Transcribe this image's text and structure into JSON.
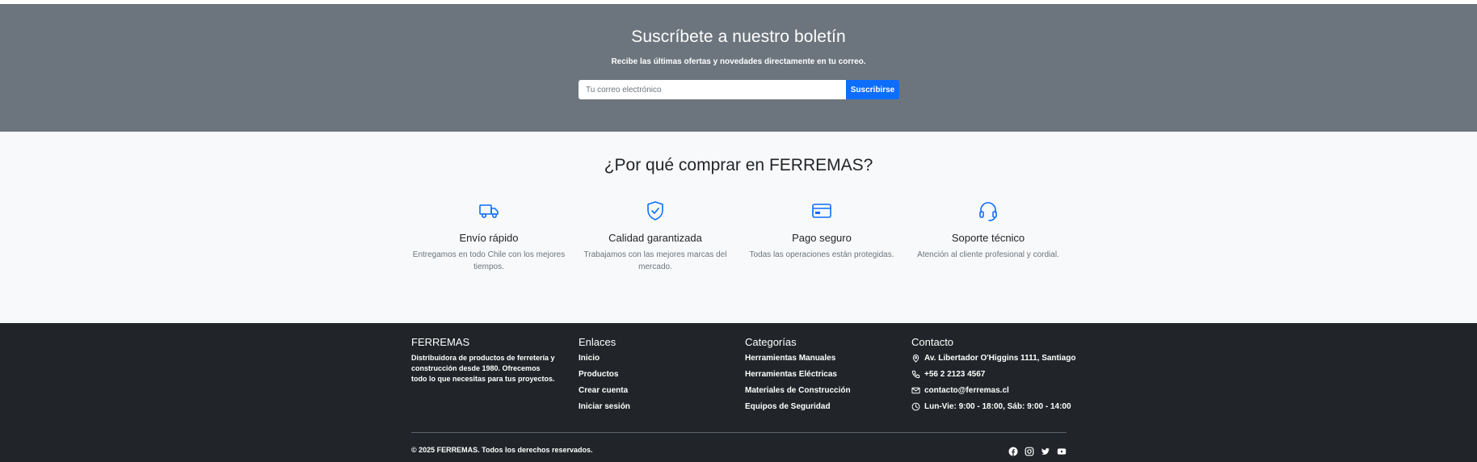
{
  "newsletter": {
    "title": "Suscríbete a nuestro boletín",
    "subtitle": "Recibe las últimas ofertas y novedades directamente en tu correo.",
    "email_placeholder": "Tu correo electrónico",
    "subscribe_label": "Suscribirse"
  },
  "why": {
    "title": "¿Por qué comprar en FERREMAS?",
    "features": [
      {
        "icon": "truck-icon",
        "title": "Envío rápido",
        "description": "Entregamos en todo Chile con los mejores tiempos."
      },
      {
        "icon": "shield-check-icon",
        "title": "Calidad garantizada",
        "description": "Trabajamos con las mejores marcas del mercado."
      },
      {
        "icon": "credit-card-icon",
        "title": "Pago seguro",
        "description": "Todas las operaciones están protegidas."
      },
      {
        "icon": "headset-icon",
        "title": "Soporte técnico",
        "description": "Atención al cliente profesional y cordial."
      }
    ]
  },
  "footer": {
    "brand": {
      "title": "FERREMAS",
      "description": "Distribuidora de productos de ferretería y construcción desde 1980. Ofrecemos todo lo que necesitas para tus proyectos."
    },
    "links": {
      "title": "Enlaces",
      "items": [
        "Inicio",
        "Productos",
        "Crear cuenta",
        "Iniciar sesión"
      ]
    },
    "categories": {
      "title": "Categorías",
      "items": [
        "Herramientas Manuales",
        "Herramientas Eléctricas",
        "Materiales de Construcción",
        "Equipos de Seguridad"
      ]
    },
    "contact": {
      "title": "Contacto",
      "address": "Av. Libertador O'Higgins 1111, Santiago",
      "phone": "+56 2 2123 4567",
      "email": "contacto@ferremas.cl",
      "hours": "Lun-Vie: 9:00 - 18:00, Sáb: 9:00 - 14:00"
    },
    "copyright": "© 2025 FERREMAS. Todos los derechos reservados.",
    "socials": [
      "facebook-icon",
      "instagram-icon",
      "twitter-icon",
      "youtube-icon"
    ]
  },
  "colors": {
    "newsletter_bg": "#6c757d",
    "accent": "#0d6efd",
    "section_bg": "#f8f9fa",
    "footer_bg": "#212529"
  }
}
